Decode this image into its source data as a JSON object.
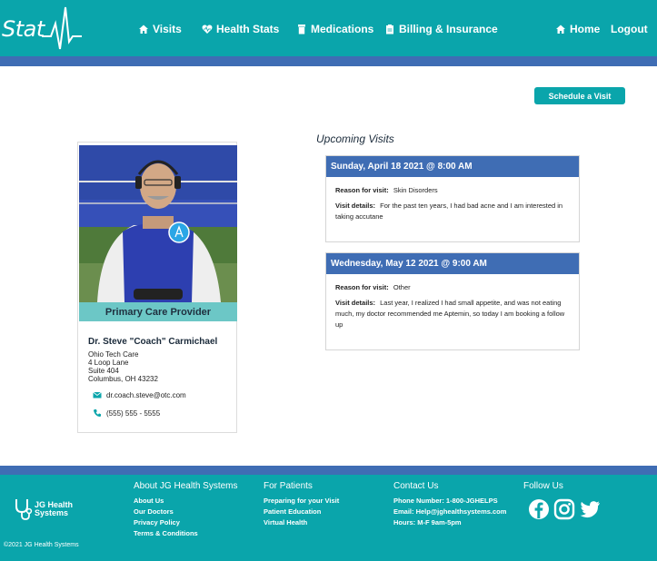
{
  "brand": {
    "logo_text": "Stat"
  },
  "nav": {
    "visits": "Visits",
    "health_stats": "Health Stats",
    "medications": "Medications",
    "billing": "Billing & Insurance",
    "home": "Home",
    "logout": "Logout"
  },
  "actions": {
    "schedule_visit": "Schedule a Visit"
  },
  "provider": {
    "banner": "Primary Care Provider",
    "name": "Dr. Steve \"Coach\" Carmichael",
    "org": "Ohio Tech Care",
    "address1": "4 Loop Lane",
    "address2": "Suite 404",
    "city_state_zip": "Columbus, OH 43232",
    "email": "dr.coach.steve@otc.com",
    "phone": "(555) 555 - 5555"
  },
  "visits": {
    "title": "Upcoming Visits",
    "reason_label": "Reason for visit:",
    "details_label": "Visit details:",
    "items": [
      {
        "datetime": "Sunday, April 18 2021 @ 8:00 AM",
        "reason": "Skin Disorders",
        "details": "For the past ten years, I had bad acne and I am interested in taking accutane"
      },
      {
        "datetime": "Wednesday, May 12 2021 @ 9:00 AM",
        "reason": "Other",
        "details": "Last year, I realized I had small appetite, and was not eating much, my doctor recommended me Aptemin, so today I am booking a follow up"
      }
    ]
  },
  "footer": {
    "logo_line1": "JG Health",
    "logo_line2": "Systems",
    "about": {
      "title": "About JG Health Systems",
      "links": [
        "About Us",
        "Our Doctors",
        "Privacy Policy",
        "Terms & Conditions"
      ]
    },
    "patients": {
      "title": "For Patients",
      "links": [
        "Preparing for your Visit",
        "Patient Education",
        "Virtual Health"
      ]
    },
    "contact": {
      "title": "Contact Us",
      "lines": [
        "Phone Number: 1-800-JGHELPS",
        "Email: Help@jghealthsystems.com",
        "Hours: M-F 9am-5pm"
      ]
    },
    "follow": {
      "title": "Follow Us"
    },
    "copyright": "©2021 JG Health Systems"
  },
  "colors": {
    "teal": "#0aa5ab",
    "blue": "#3f6db4",
    "banner": "#6cc7c6"
  }
}
